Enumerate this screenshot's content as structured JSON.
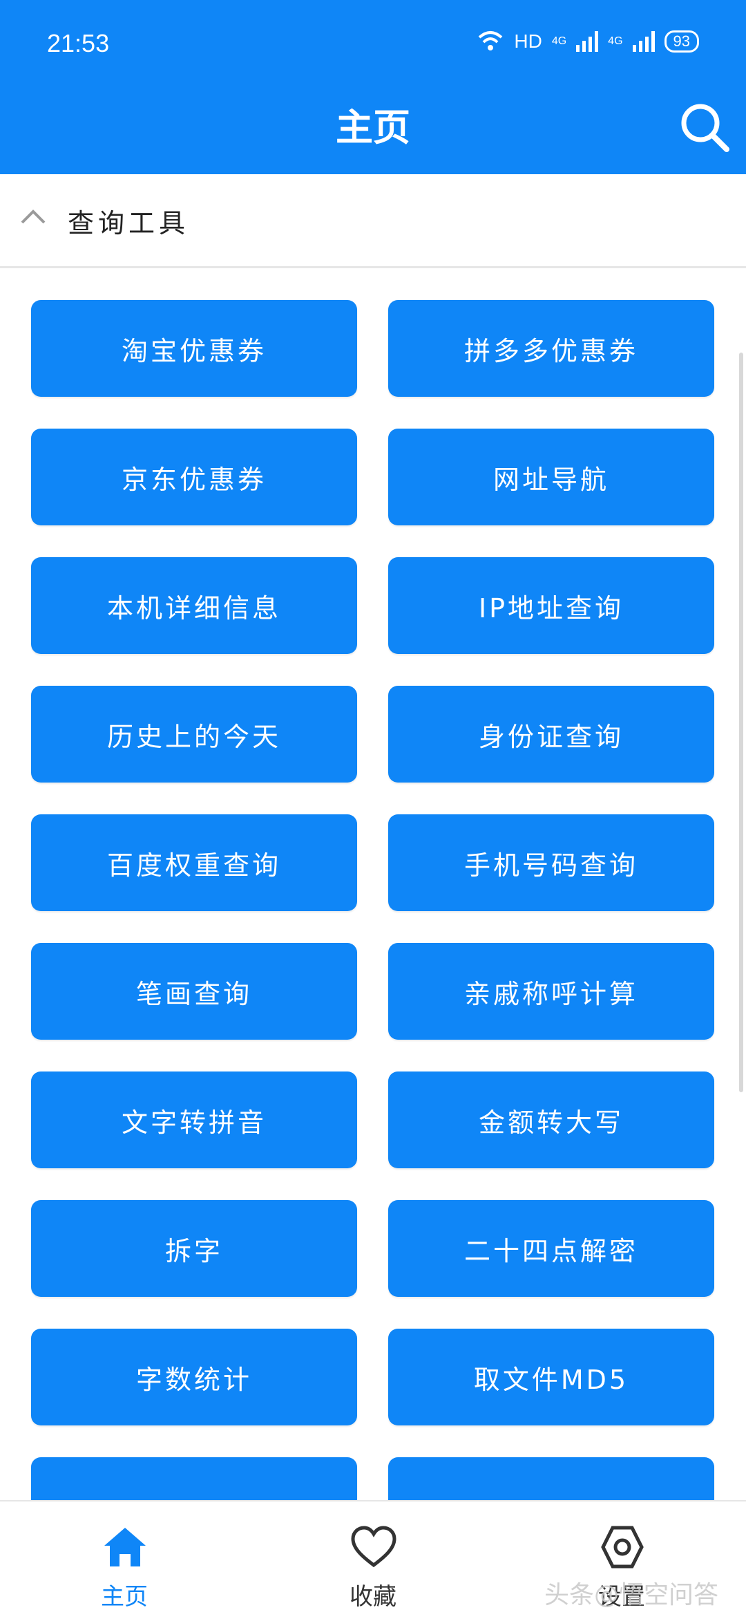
{
  "status_bar": {
    "time": "21:53",
    "network": "HD",
    "signal_1": "4G",
    "signal_2": "4G",
    "battery": "93"
  },
  "header": {
    "title": "主页",
    "search_icon": "search-icon"
  },
  "section": {
    "title": "查询工具",
    "toggle_icon": "chevron-up-icon"
  },
  "tools": [
    "淘宝优惠券",
    "拼多多优惠券",
    "京东优惠券",
    "网址导航",
    "本机详细信息",
    "IP地址查询",
    "历史上的今天",
    "身份证查询",
    "百度权重查询",
    "手机号码查询",
    "笔画查询",
    "亲戚称呼计算",
    "文字转拼音",
    "金额转大写",
    "拆字",
    "二十四点解密",
    "字数统计",
    "取文件MD5",
    "",
    ""
  ],
  "bottom_nav": {
    "items": [
      {
        "label": "主页",
        "icon": "home-icon",
        "active": true
      },
      {
        "label": "收藏",
        "icon": "heart-icon",
        "active": false
      },
      {
        "label": "设置",
        "icon": "settings-icon",
        "active": false
      }
    ]
  },
  "watermark": "头条@悟空问答",
  "colors": {
    "primary": "#0F86F7",
    "active_nav": "#0F86F7",
    "inactive_nav": "#333333"
  }
}
